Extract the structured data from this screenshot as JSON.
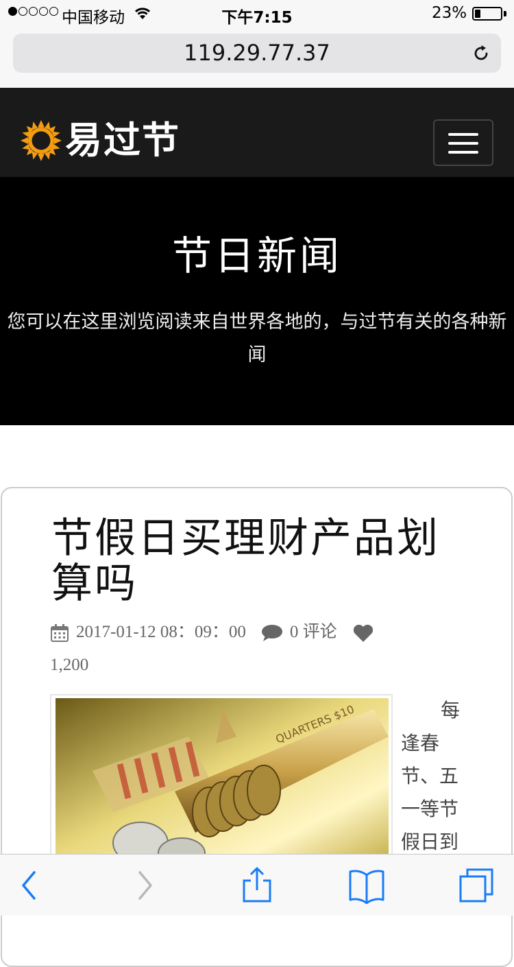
{
  "status_bar": {
    "carrier": "中国移动",
    "time": "下午7:15",
    "battery_percent": "23%",
    "battery_level": 0.23,
    "signal_bars_filled": 1,
    "signal_bars_total": 5,
    "icons": [
      "wifi-icon",
      "battery-icon"
    ]
  },
  "browser": {
    "url": "119.29.77.37",
    "icons": [
      "reload-icon"
    ]
  },
  "navbar": {
    "brand": "易过节",
    "logo_icon": "sun-icon",
    "menu_icon": "hamburger-icon"
  },
  "hero": {
    "title": "节日新闻",
    "subtitle": "您可以在这里浏览阅读来自世界各地的，与过节有关的各种新闻"
  },
  "article": {
    "title": "节假日买理财产品划算吗",
    "date": "2017-01-12 08：09：00",
    "comments": "0 评论",
    "likes": "1,200",
    "excerpt": "每逢春节、五一等节假日到",
    "icons": [
      "calendar-icon",
      "comment-icon",
      "heart-icon"
    ],
    "image_alt": "coins-image"
  },
  "toolbar": {
    "icons": [
      "back-icon",
      "forward-icon",
      "share-icon",
      "bookmarks-icon",
      "tabs-icon"
    ]
  },
  "colors": {
    "navbar_bg": "#1a1a1a",
    "hero_bg": "#000000",
    "sun_orange": "#f39c12",
    "ios_blue": "#1a7cf5",
    "meta_gray": "#666666"
  }
}
